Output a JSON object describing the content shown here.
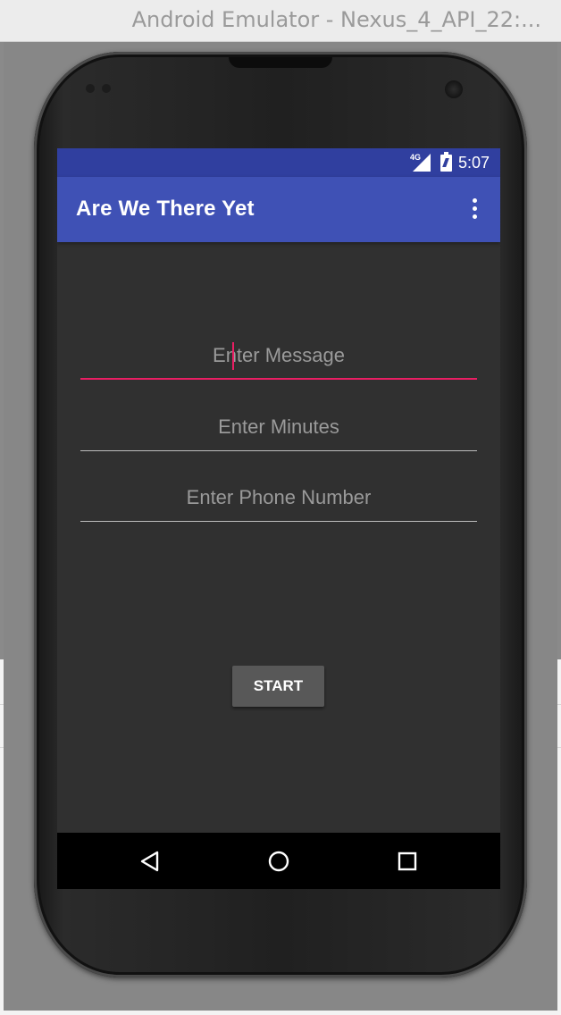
{
  "window": {
    "title": "Android Emulator - Nexus_4_API_22:..."
  },
  "status_bar": {
    "network": "4G",
    "time": "5:07",
    "icons": [
      "signal-icon",
      "battery-charging-icon"
    ]
  },
  "app_bar": {
    "title": "Are We There Yet",
    "overflow_icon": "overflow-menu-icon"
  },
  "form": {
    "message_field": {
      "placeholder": "Enter Message",
      "value": ""
    },
    "minutes_field": {
      "placeholder": "Enter Minutes",
      "value": ""
    },
    "phone_field": {
      "placeholder": "Enter Phone Number",
      "value": ""
    },
    "start_button": "START"
  },
  "nav_bar": {
    "icons": [
      "back-icon",
      "home-icon",
      "recents-icon"
    ]
  },
  "colors": {
    "status_bar": "#303f9f",
    "app_bar": "#3f51b5",
    "accent": "#e91e63",
    "screen_background": "#303030",
    "button": "#585858"
  }
}
